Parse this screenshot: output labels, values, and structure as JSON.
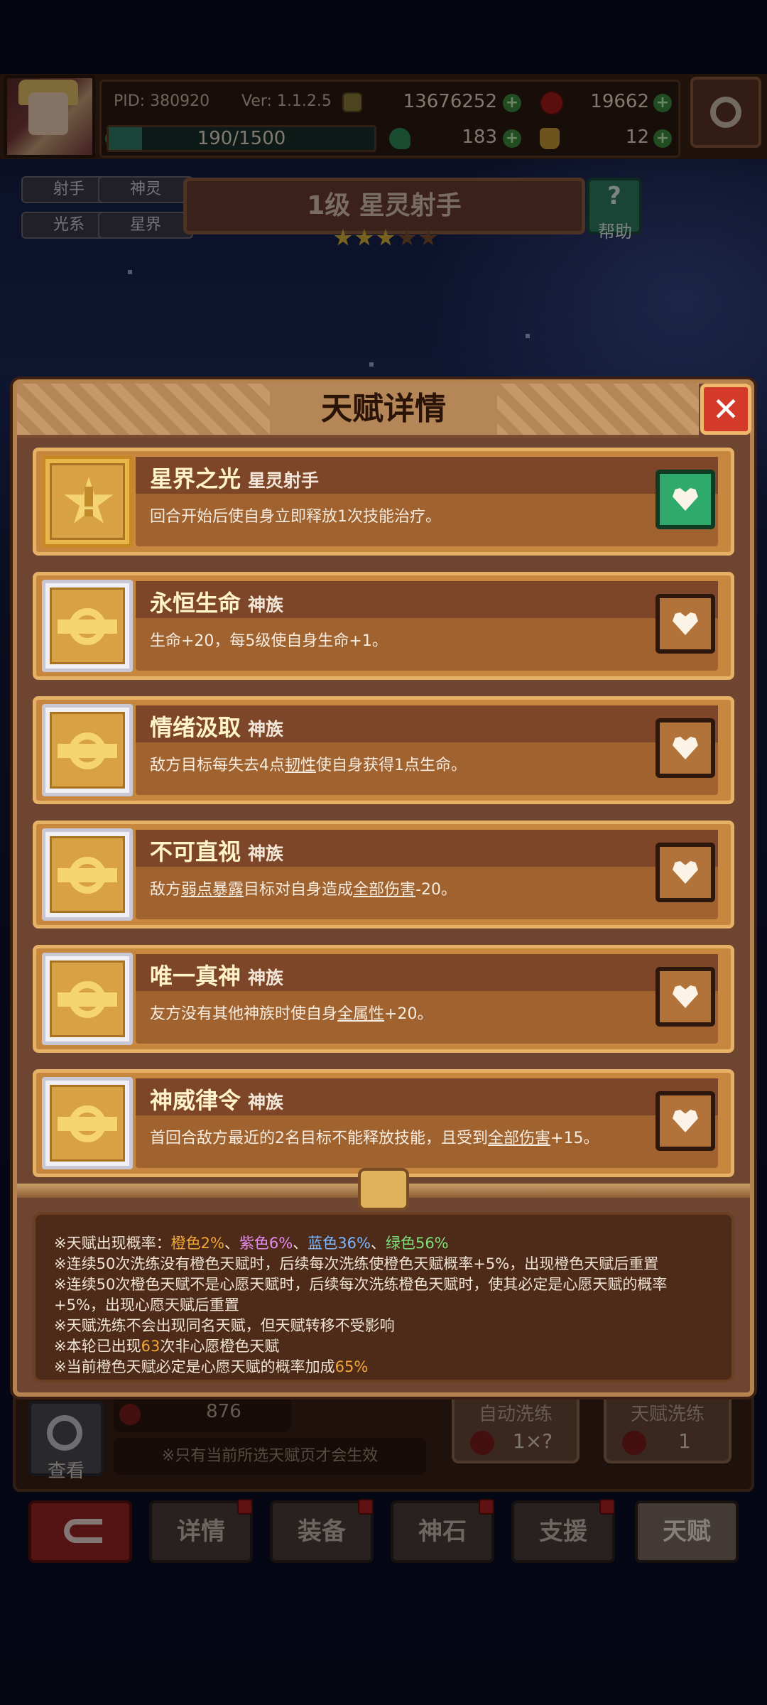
{
  "player": {
    "pid": "PID: 380920",
    "version": "Ver: 1.1.2.5",
    "gold": "13676252",
    "apples": "19662",
    "energy": "190/1500",
    "energy_fraction": 0.127,
    "clover": "183",
    "pouch": "12"
  },
  "hero": {
    "tags": [
      "射手",
      "神灵",
      "光系",
      "星界"
    ],
    "title": "1级  星灵射手",
    "stars_total": 5,
    "stars_filled": 3,
    "help_label": "帮助",
    "help_icon": "?"
  },
  "modal": {
    "title": "天赋详情",
    "close": "✕",
    "talents": [
      {
        "name": "星界之光",
        "tag": "星灵射手",
        "desc": [
          {
            "t": "回合开始后使自身立即释放1次技能治疗。"
          }
        ],
        "icon": "star",
        "selected": true
      },
      {
        "name": "永恒生命",
        "tag": "神族",
        "desc": [
          {
            "t": "生命+20，每5级使自身生命+1。"
          }
        ],
        "icon": "ring",
        "selected": false
      },
      {
        "name": "情绪汲取",
        "tag": "神族",
        "desc": [
          {
            "t": "敌方目标每失去4点"
          },
          {
            "t": "韧性",
            "u": true
          },
          {
            "t": "使自身获得1点生命。"
          }
        ],
        "icon": "ring",
        "selected": false
      },
      {
        "name": "不可直视",
        "tag": "神族",
        "desc": [
          {
            "t": "敌方"
          },
          {
            "t": "弱点暴露",
            "u": true
          },
          {
            "t": "目标对自身造成"
          },
          {
            "t": "全部伤害",
            "u": true
          },
          {
            "t": "-20。"
          }
        ],
        "icon": "ring",
        "selected": false
      },
      {
        "name": "唯一真神",
        "tag": "神族",
        "desc": [
          {
            "t": "友方没有其他神族时使自身"
          },
          {
            "t": "全属性",
            "u": true
          },
          {
            "t": "+20。"
          }
        ],
        "icon": "ring",
        "selected": false
      },
      {
        "name": "神威律令",
        "tag": "神族",
        "desc": [
          {
            "t": "首回合敌方最近的2名目标不能释放技能，且受到"
          },
          {
            "t": "全部伤害",
            "u": true
          },
          {
            "t": "+15。"
          }
        ],
        "icon": "ring",
        "selected": false
      }
    ],
    "info": {
      "line1_prefix": "※天赋出现概率：",
      "orange": "橙色2%",
      "sep1": "、",
      "purple": "紫色6%",
      "sep2": "、",
      "blue": "蓝色36%",
      "sep3": "、",
      "green": "绿色56%",
      "line2": "※连续50次洗练没有橙色天赋时，后续每次洗练使橙色天赋概率+5%，出现橙色天赋后重置",
      "line3": "※连续50次橙色天赋不是心愿天赋时，后续每次洗练橙色天赋时，使其必定是心愿天赋的概率",
      "line4": "+5%，出现心愿天赋后重置",
      "line5": "※天赋洗练不会出现同名天赋，但天赋转移不受影响",
      "line6_a": "※本轮已出现",
      "line6_num": "63",
      "line6_b": "次非心愿橙色天赋",
      "line7_a": "※当前橙色天赋必定是心愿天赋的概率加成",
      "line7_num": "65%"
    }
  },
  "lower": {
    "search_label": "查看",
    "apple_count": "876",
    "note": "※只有当前所选天赋页才会生效",
    "auto_wash": {
      "title": "自动洗练",
      "cost": "1×?"
    },
    "talent_wash": {
      "title": "天赋洗练",
      "cost": "1"
    }
  },
  "nav": {
    "items": [
      "详情",
      "装备",
      "神石",
      "支援",
      "天赋"
    ],
    "active": "天赋"
  },
  "colors": {
    "modal_bg": "#6e4530",
    "card_bg": "#c8873e",
    "accent_orange": "#f2a838",
    "accent_green": "#2faa6a",
    "close_red": "#d33a2a"
  }
}
